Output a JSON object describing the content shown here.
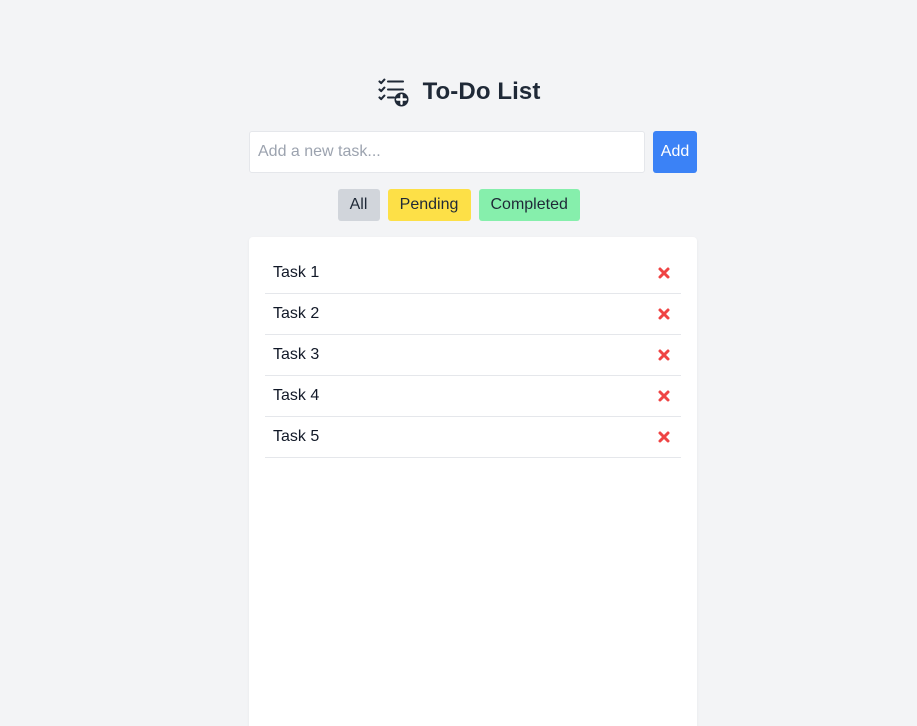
{
  "app": {
    "title": "To-Do List",
    "header_icon": "task-list-add-icon"
  },
  "new_task": {
    "value": "",
    "placeholder": "Add a new task...",
    "add_label": "Add"
  },
  "filters": [
    {
      "label": "All",
      "color": "#d1d5db"
    },
    {
      "label": "Pending",
      "color": "#fde047"
    },
    {
      "label": "Completed",
      "color": "#86efac"
    }
  ],
  "tasks": [
    {
      "label": "Task 1",
      "delete_icon": "close-icon"
    },
    {
      "label": "Task 2",
      "delete_icon": "close-icon"
    },
    {
      "label": "Task 3",
      "delete_icon": "close-icon"
    },
    {
      "label": "Task 4",
      "delete_icon": "close-icon"
    },
    {
      "label": "Task 5",
      "delete_icon": "close-icon"
    }
  ],
  "colors": {
    "background": "#f3f4f6",
    "accent": "#3b82f6",
    "delete": "#ef4444",
    "title": "#1f2937"
  }
}
